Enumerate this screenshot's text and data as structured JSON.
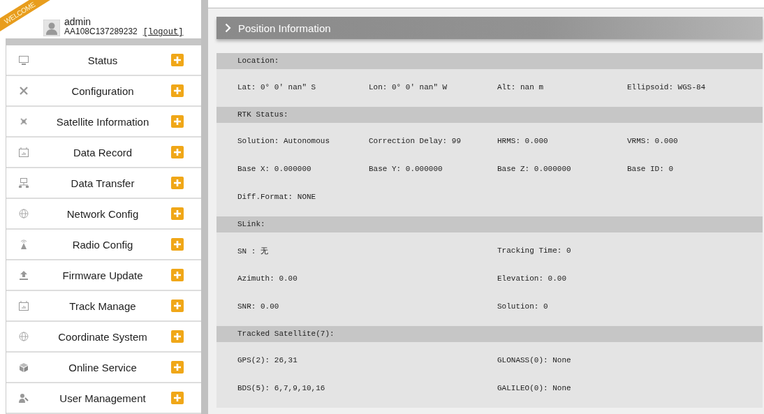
{
  "user": {
    "ribbon": "WELCOME",
    "name": "admin",
    "device": "AA108C137289232",
    "logout": "[logout]"
  },
  "menu": [
    {
      "label": "Status"
    },
    {
      "label": "Configuration"
    },
    {
      "label": "Satellite Information"
    },
    {
      "label": "Data Record"
    },
    {
      "label": "Data Transfer"
    },
    {
      "label": "Network Config"
    },
    {
      "label": "Radio Config"
    },
    {
      "label": "Firmware Update"
    },
    {
      "label": "Track Manage"
    },
    {
      "label": "Coordinate System"
    },
    {
      "label": "Online Service"
    },
    {
      "label": "User Management"
    }
  ],
  "panel": {
    "title": "Position Information",
    "sections": [
      {
        "title": "Location:",
        "kind": "quad",
        "rows": [
          [
            "Lat: 0° 0′ nan″ S",
            "Lon: 0° 0′ nan″ W",
            "Alt: nan m",
            "Ellipsoid: WGS-84"
          ]
        ]
      },
      {
        "title": "RTK Status:",
        "kind": "quad",
        "rows": [
          [
            "Solution: Autonomous",
            "Correction Delay: 99",
            "HRMS: 0.000",
            "VRMS: 0.000"
          ],
          [
            "Base X: 0.000000",
            "Base Y: 0.000000",
            "Base Z: 0.000000",
            "Base ID: 0"
          ],
          [
            "Diff.Format: NONE"
          ]
        ]
      },
      {
        "title": "SLink:",
        "kind": "pair",
        "rows": [
          [
            "SN : 无",
            "Tracking Time: 0"
          ],
          [
            "Azimuth: 0.00",
            "Elevation: 0.00"
          ],
          [
            "SNR: 0.00",
            "Solution: 0"
          ]
        ]
      },
      {
        "title": "Tracked Satellite(7):",
        "kind": "pair",
        "rows": [
          [
            "GPS(2): 26,31",
            "GLONASS(0): None"
          ],
          [
            "BDS(5): 6,7,9,10,16",
            "GALILEO(0): None"
          ]
        ]
      }
    ]
  }
}
